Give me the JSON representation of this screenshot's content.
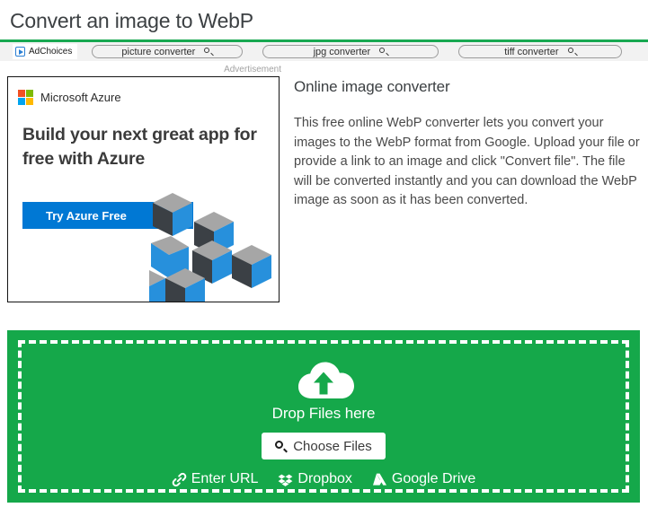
{
  "page": {
    "title": "Convert an image to WebP"
  },
  "ad_strip": {
    "adchoices_label": "AdChoices",
    "adchoices_icon": "adchoices-triangle-icon",
    "search_icon": "magnifier-icon",
    "pills": [
      {
        "label": "picture converter"
      },
      {
        "label": "jpg converter"
      },
      {
        "label": "tiff converter"
      }
    ]
  },
  "advertisement": {
    "label": "Advertisement",
    "brand": "Microsoft Azure",
    "logo_icon": "microsoft-logo-icon",
    "logo_colors": {
      "top_left": "#f25022",
      "top_right": "#7fba00",
      "bottom_left": "#00a4ef",
      "bottom_right": "#ffb900"
    },
    "headline": "Build your next great app for free with Azure",
    "cta_label": "Try Azure Free",
    "cta_icon": "chevron-right-icon",
    "cta_color": "#0078d4",
    "graphic_icon": "isometric-cubes-graphic",
    "cube_colors": {
      "top": "#a6a6a6",
      "left": "#3b4045",
      "right": "#2790dc"
    }
  },
  "intro": {
    "heading": "Online image converter",
    "body": "This free online WebP converter lets you convert your images to the WebP format from Google. Upload your file or provide a link to an image and click \"Convert file\". The file will be converted instantly and you can download the WebP image as soon as it has been converted."
  },
  "dropzone": {
    "background_color": "#15a84a",
    "cloud_icon": "cloud-upload-icon",
    "drop_label": "Drop Files here",
    "choose_files_label": "Choose Files",
    "choose_files_icon": "magnifier-icon",
    "sources": [
      {
        "label": "Enter URL",
        "icon": "link-icon"
      },
      {
        "label": "Dropbox",
        "icon": "dropbox-icon"
      },
      {
        "label": "Google Drive",
        "icon": "google-drive-icon"
      }
    ]
  }
}
